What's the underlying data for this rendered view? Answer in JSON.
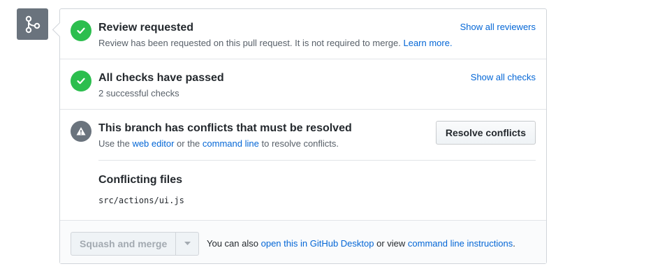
{
  "review": {
    "title": "Review requested",
    "description": "Review has been requested on this pull request. It is not required to merge.",
    "learn_more": "Learn more.",
    "show_reviewers": "Show all reviewers"
  },
  "checks": {
    "title": "All checks have passed",
    "description": "2 successful checks",
    "show_checks": "Show all checks"
  },
  "conflicts": {
    "title": "This branch has conflicts that must be resolved",
    "desc_prefix": "Use the",
    "web_editor": "web editor",
    "desc_middle": "or the",
    "command_line": "command line",
    "desc_suffix": "to resolve conflicts.",
    "resolve_button": "Resolve conflicts",
    "files_title": "Conflicting files",
    "files": [
      "src/actions/ui.js"
    ]
  },
  "merge": {
    "button_label": "Squash and merge",
    "text_prefix": "You can also",
    "desktop_link": "open this in GitHub Desktop",
    "text_middle": "or view",
    "instructions_link": "command line instructions",
    "text_suffix": "."
  },
  "colors": {
    "success": "#2cbe4e",
    "neutral": "#6a737d",
    "link": "#0366d6"
  },
  "icons": {
    "merge_badge": "git-merge-icon",
    "review_status": "check-icon",
    "checks_status": "check-icon",
    "conflict_status": "alert-icon",
    "dropdown": "triangle-down-icon"
  }
}
